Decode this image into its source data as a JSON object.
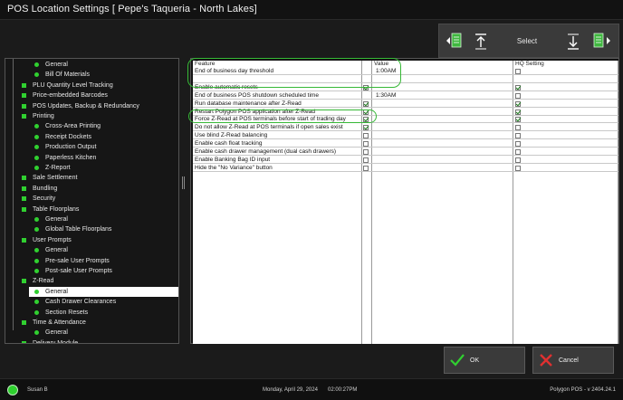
{
  "window": {
    "title": "POS Location Settings [ Pepe's Taqueria - North Lakes]"
  },
  "toolbar": {
    "select_label": "Select"
  },
  "tree": [
    {
      "label": "General",
      "level": 1
    },
    {
      "label": "Bill Of Materials",
      "level": 1
    },
    {
      "label": "PLU Quantity Level Tracking",
      "level": 0
    },
    {
      "label": "Price-embedded Barcodes",
      "level": 0
    },
    {
      "label": "POS Updates, Backup & Redundancy",
      "level": 0
    },
    {
      "label": "Printing",
      "level": 0
    },
    {
      "label": "Cross-Area Printing",
      "level": 1
    },
    {
      "label": "Receipt Dockets",
      "level": 1
    },
    {
      "label": "Production Output",
      "level": 1
    },
    {
      "label": "Paperless Kitchen",
      "level": 1
    },
    {
      "label": "Z-Report",
      "level": 1
    },
    {
      "label": "Sale Settlement",
      "level": 0
    },
    {
      "label": "Bundling",
      "level": 0
    },
    {
      "label": "Security",
      "level": 0
    },
    {
      "label": "Table Floorplans",
      "level": 0
    },
    {
      "label": "General",
      "level": 1
    },
    {
      "label": "Global Table Floorplans",
      "level": 1
    },
    {
      "label": "User Prompts",
      "level": 0
    },
    {
      "label": "General",
      "level": 1
    },
    {
      "label": "Pre-sale User Prompts",
      "level": 1
    },
    {
      "label": "Post-sale User Prompts",
      "level": 1
    },
    {
      "label": "Z-Read",
      "level": 0
    },
    {
      "label": "General",
      "level": 1,
      "selected": true
    },
    {
      "label": "Cash Drawer Clearances",
      "level": 1
    },
    {
      "label": "Section Resets",
      "level": 1
    },
    {
      "label": "Time & Attendance",
      "level": 0
    },
    {
      "label": "General",
      "level": 1
    },
    {
      "label": "Delivery Module",
      "level": 0
    }
  ],
  "grid": {
    "headers": {
      "feature": "Feature",
      "value": "Value",
      "hq": "HQ Setting"
    },
    "rows": [
      {
        "feature": "End of business day threshold",
        "value": "1:00AM",
        "checked": null,
        "hq": false
      },
      {
        "feature": "",
        "value": "",
        "checked": null,
        "hq": null
      },
      {
        "feature": "Enable automatic resets",
        "value": "",
        "checked": true,
        "hq": true
      },
      {
        "feature": "End of business POS shutdown scheduled time",
        "value": "1:30AM",
        "checked": null,
        "hq": false
      },
      {
        "feature": "Run database maintenance after Z-Read",
        "value": "",
        "checked": true,
        "hq": true
      },
      {
        "feature": "Restart Polygon POS application after Z-Read",
        "value": "",
        "checked": true,
        "hq": true
      },
      {
        "feature": "Force Z-Read at POS terminals before start of trading day",
        "value": "",
        "checked": true,
        "hq": true
      },
      {
        "feature": "Do not allow Z-Read at POS terminals if open sales exist",
        "value": "",
        "checked": true,
        "hq": false
      },
      {
        "feature": "Use blind Z-Read balancing",
        "value": "",
        "checked": false,
        "hq": false
      },
      {
        "feature": "Enable cash float tracking",
        "value": "",
        "checked": false,
        "hq": false
      },
      {
        "feature": "Enable cash drawer management (dual cash drawers)",
        "value": "",
        "checked": false,
        "hq": false
      },
      {
        "feature": "Enable Banking Bag ID input",
        "value": "",
        "checked": false,
        "hq": false
      },
      {
        "feature": "Hide the \"No Variance\" button",
        "value": "",
        "checked": false,
        "hq": false
      }
    ]
  },
  "buttons": {
    "ok": "OK",
    "cancel": "Cancel"
  },
  "status": {
    "user": "Susan B",
    "date": "Monday, April 29, 2024",
    "time": "02:00:27PM",
    "version": "Polygon POS - v 2404.24.1"
  },
  "colors": {
    "accent_green": "#30d030",
    "annotation": "#36b836",
    "cancel_red": "#e03030"
  }
}
